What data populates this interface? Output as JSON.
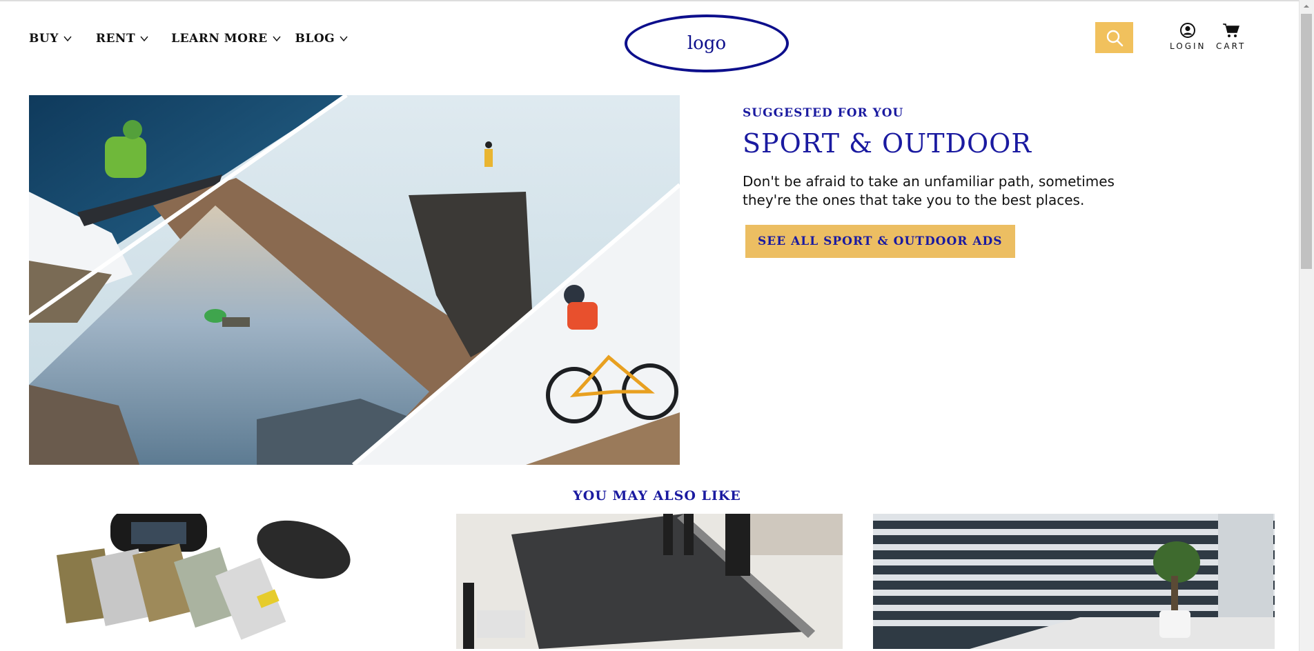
{
  "header": {
    "nav": [
      {
        "label": "BUY"
      },
      {
        "label": "RENT"
      },
      {
        "label": "LEARN MORE"
      },
      {
        "label": "BLOG"
      }
    ],
    "logo_text": "logo",
    "login_label": "LOGIN",
    "cart_label": "CART"
  },
  "hero": {
    "eyebrow": "SUGGESTED FOR YOU",
    "title": "SPORT & OUTDOOR",
    "description": "Don't be afraid to take an unfamiliar path, sometimes they're the ones that take you to the best places.",
    "cta_label": "SEE ALL SPORT & OUTDOOR ADS"
  },
  "section": {
    "title": "YOU MAY ALSO LIKE"
  },
  "colors": {
    "brand_blue": "#1a1aa0",
    "accent_yellow": "#ecbe62"
  },
  "icons": {
    "search": "search-icon",
    "user": "user-icon",
    "cart": "cart-icon",
    "chevron": "chevron-down-icon"
  }
}
